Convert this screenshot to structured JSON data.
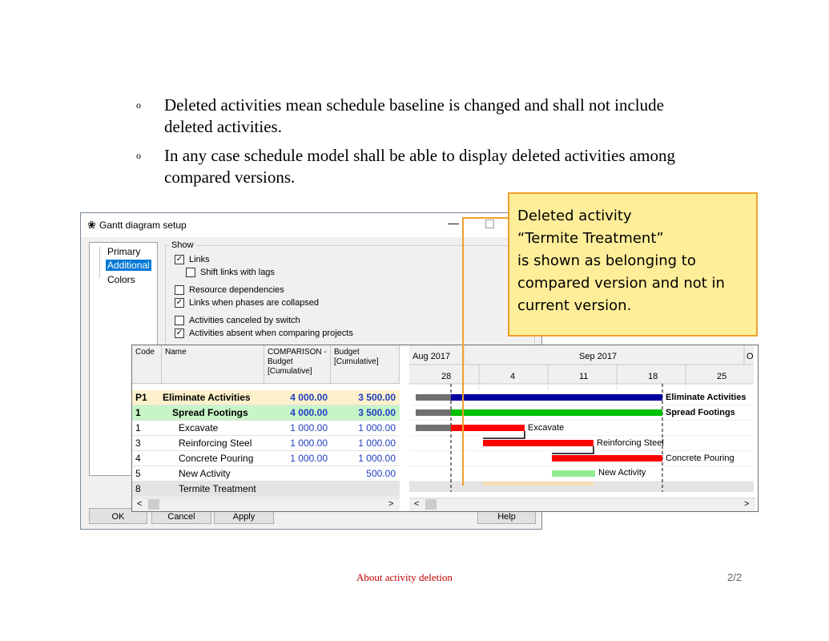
{
  "bullets": [
    {
      "marker": "o",
      "text": "Deleted activities mean schedule baseline is changed and shall not include deleted activities."
    },
    {
      "marker": "o",
      "text": "In any case schedule model shall be able to display deleted activities among compared versions."
    }
  ],
  "dialog": {
    "title": "Gantt diagram setup",
    "icon": "gear-flower-icon",
    "minimize": "—",
    "tree": [
      "Primary",
      "Additional",
      "Colors"
    ],
    "selected_tree_item": "Additional",
    "show_label": "Show",
    "options": [
      {
        "label": "Links",
        "checked": true
      },
      {
        "label": "Shift links with lags",
        "checked": false
      },
      {
        "label": "Resource dependencies",
        "checked": false
      },
      {
        "label": "Links when phases are collapsed",
        "checked": true
      },
      {
        "label": "Activities canceled by switch",
        "checked": false
      },
      {
        "label": "Activities absent when comparing projects",
        "checked": true
      }
    ],
    "buttons": {
      "ok": "OK",
      "cancel": "Cancel",
      "apply": "Apply",
      "help": "Help"
    }
  },
  "gantt": {
    "columns": {
      "code": "Code",
      "name": "Name",
      "comparison_l1": "COMPARISON -",
      "comparison_l2": "Budget",
      "comparison_l3": "[Cumulative]",
      "budget_l1": "Budget",
      "budget_l2": "[Cumulative]"
    },
    "timeline": {
      "aug": "Aug 2017",
      "sep": "Sep 2017",
      "oct": "Oc",
      "days": [
        "28",
        "4",
        "11",
        "18",
        "25"
      ]
    },
    "rows": [
      {
        "code": "P1",
        "name": "Eliminate Activities",
        "comparison": "4 000.00",
        "budget": "3 500.00",
        "style": "p1"
      },
      {
        "code": "1",
        "name": "Spread Footings",
        "comparison": "4 000.00",
        "budget": "3 500.00",
        "style": "sf"
      },
      {
        "code": "1",
        "name": "Excavate",
        "comparison": "1 000.00",
        "budget": "1 000.00",
        "style": "norm"
      },
      {
        "code": "3",
        "name": "Reinforcing Steel",
        "comparison": "1 000.00",
        "budget": "1 000.00",
        "style": "norm"
      },
      {
        "code": "4",
        "name": "Concrete Pouring",
        "comparison": "1 000.00",
        "budget": "1 000.00",
        "style": "norm"
      },
      {
        "code": "5",
        "name": "New Activity",
        "comparison": "",
        "budget": "500.00",
        "style": "norm"
      },
      {
        "code": "8",
        "name": "Termite Treatment",
        "comparison": "",
        "budget": "",
        "style": "deleted"
      }
    ],
    "bar_labels": [
      "Eliminate Activities",
      "Spread Footings",
      "Excavate",
      "Reinforcing Steel",
      "Concrete Pouring",
      "New Activity"
    ],
    "colors": {
      "phase": "#0000a0",
      "summary": "#00c000",
      "activity": "#ff0000",
      "new": "#90ee90",
      "deleted": "#f8dcb8",
      "baseline": "#707070"
    },
    "scroll_left": "<",
    "scroll_right": ">"
  },
  "callout": {
    "lines": [
      "Deleted activity",
      "“Termite Treatment”",
      "is shown as belonging to",
      "compared version and not in",
      "current version."
    ],
    "border_color": "#f0a030"
  },
  "footer": {
    "title": "About activity deletion",
    "page": "2/2"
  }
}
